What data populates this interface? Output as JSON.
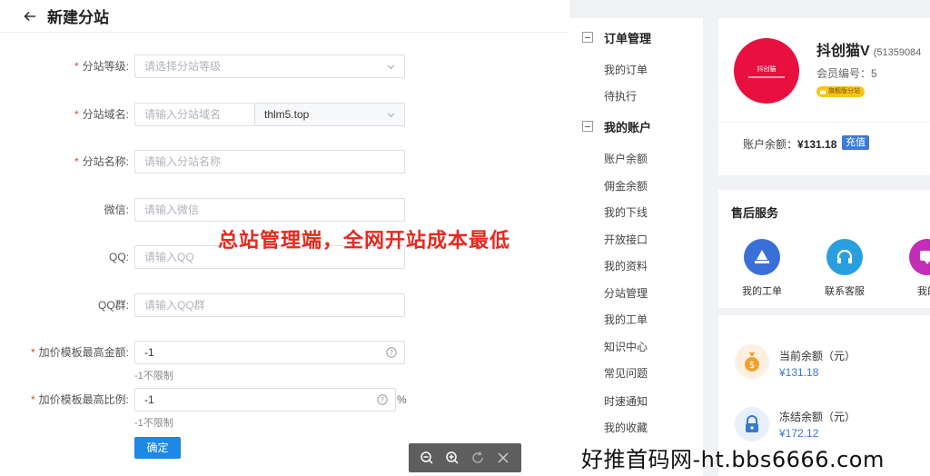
{
  "header": {
    "title": "新建分站"
  },
  "form": {
    "level": {
      "label": "分站等级:",
      "placeholder": "请选择分站等级"
    },
    "domain": {
      "label": "分站域名:",
      "placeholder": "请输入分站域名",
      "suffix": "thlm5.top"
    },
    "name": {
      "label": "分站名称:",
      "placeholder": "请输入分站名称"
    },
    "wechat": {
      "label": "微信:",
      "placeholder": "请输入微信"
    },
    "qq": {
      "label": "QQ:",
      "placeholder": "请输入QQ"
    },
    "qqgroup": {
      "label": "QQ群:",
      "placeholder": "请输入QQ群"
    },
    "max_amount": {
      "label": "加价模板最高金额:",
      "value": "-1",
      "hint": "-1不限制"
    },
    "max_ratio": {
      "label": "加价模板最高比例:",
      "value": "-1",
      "hint": "-1不限制",
      "unit": "%"
    },
    "confirm_label": "确定"
  },
  "overlay_text": "总站管理端，全网开站成本最低",
  "site_watermark": "好推首码网-ht.bbs6666.com",
  "menu": {
    "order_section": "订单管理",
    "order_items": [
      "我的订单",
      "待执行"
    ],
    "account_section": "我的账户",
    "account_items": [
      "账户余额",
      "佣金余额",
      "我的下线",
      "开放接口",
      "我的资料",
      "分站管理",
      "我的工单",
      "知识中心",
      "常见问题",
      "时速通知",
      "我的收藏"
    ]
  },
  "profile": {
    "logo_text": "抖创猫",
    "name": "抖创猫V",
    "id": "(51359084",
    "member_no": "会员编号：5",
    "badge": "旗舰版分站",
    "balance_label": "账户余额：",
    "balance_value": "¥131.18",
    "recharge_label": "充值"
  },
  "after_sales": {
    "title": "售后服务",
    "items": [
      {
        "label": "我的工单",
        "icon": "ticket-icon",
        "color": "#3b6fd8"
      },
      {
        "label": "联系客服",
        "icon": "headset-icon",
        "color": "#2a9fe0"
      },
      {
        "label": "我的",
        "icon": "message-icon",
        "color": "#c22fb6"
      }
    ]
  },
  "funds": {
    "current_label": "当前余额（元）",
    "current_value": "¥131.18",
    "frozen_label": "冻结余额（元）",
    "frozen_value": "¥172.12"
  }
}
